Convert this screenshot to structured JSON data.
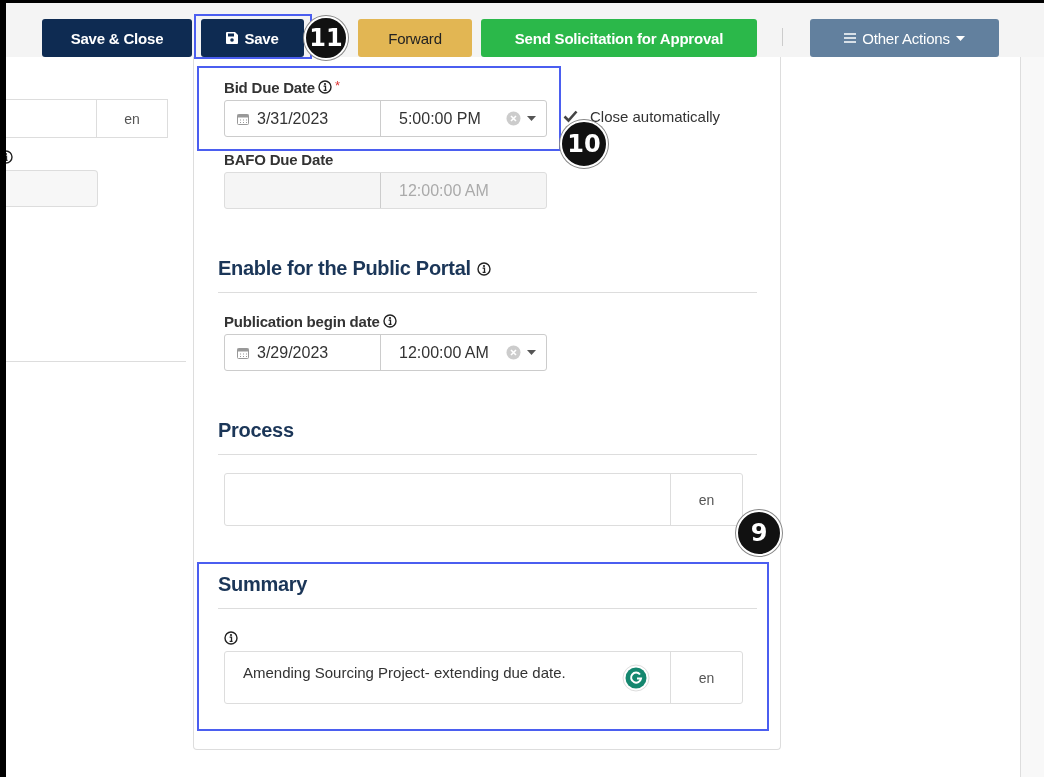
{
  "toolbar": {
    "buttons": [
      {
        "label": "Save & Close",
        "kind": "primary",
        "highlighted": false
      },
      {
        "label": "Save",
        "kind": "save",
        "highlighted": true,
        "callout": "11"
      },
      {
        "label": "Forward",
        "kind": "warning",
        "highlighted": false
      },
      {
        "label": "Send Solicitation for Approval",
        "kind": "success",
        "highlighted": false
      },
      {
        "label": "Other Actions",
        "kind": "menu",
        "highlighted": false
      }
    ]
  },
  "left_column": {
    "fields": [
      {
        "kind": "localized",
        "lang": "en"
      },
      {
        "kind": "disabled"
      }
    ]
  },
  "bid_due_date": {
    "label": "Bid Due Date",
    "required_mark": "*",
    "date": "3/31/2023",
    "time": "5:00:00 PM",
    "highlighted": true,
    "callout": "10",
    "close_automatically": {
      "label": "Close automatically",
      "checked": true
    }
  },
  "bafo_due_date": {
    "label": "BAFO Due Date",
    "time": "12:00:00 AM",
    "disabled": true
  },
  "public_portal": {
    "heading": "Enable for the Public Portal",
    "field": {
      "label": "Publication begin date",
      "date": "3/29/2023",
      "time": "12:00:00 AM"
    }
  },
  "process": {
    "heading": "Process",
    "lang": "en"
  },
  "summary": {
    "heading": "Summary",
    "value": "Amending Sourcing Project- extending due date.",
    "lang": "en",
    "highlighted": true,
    "callout": "9"
  }
}
